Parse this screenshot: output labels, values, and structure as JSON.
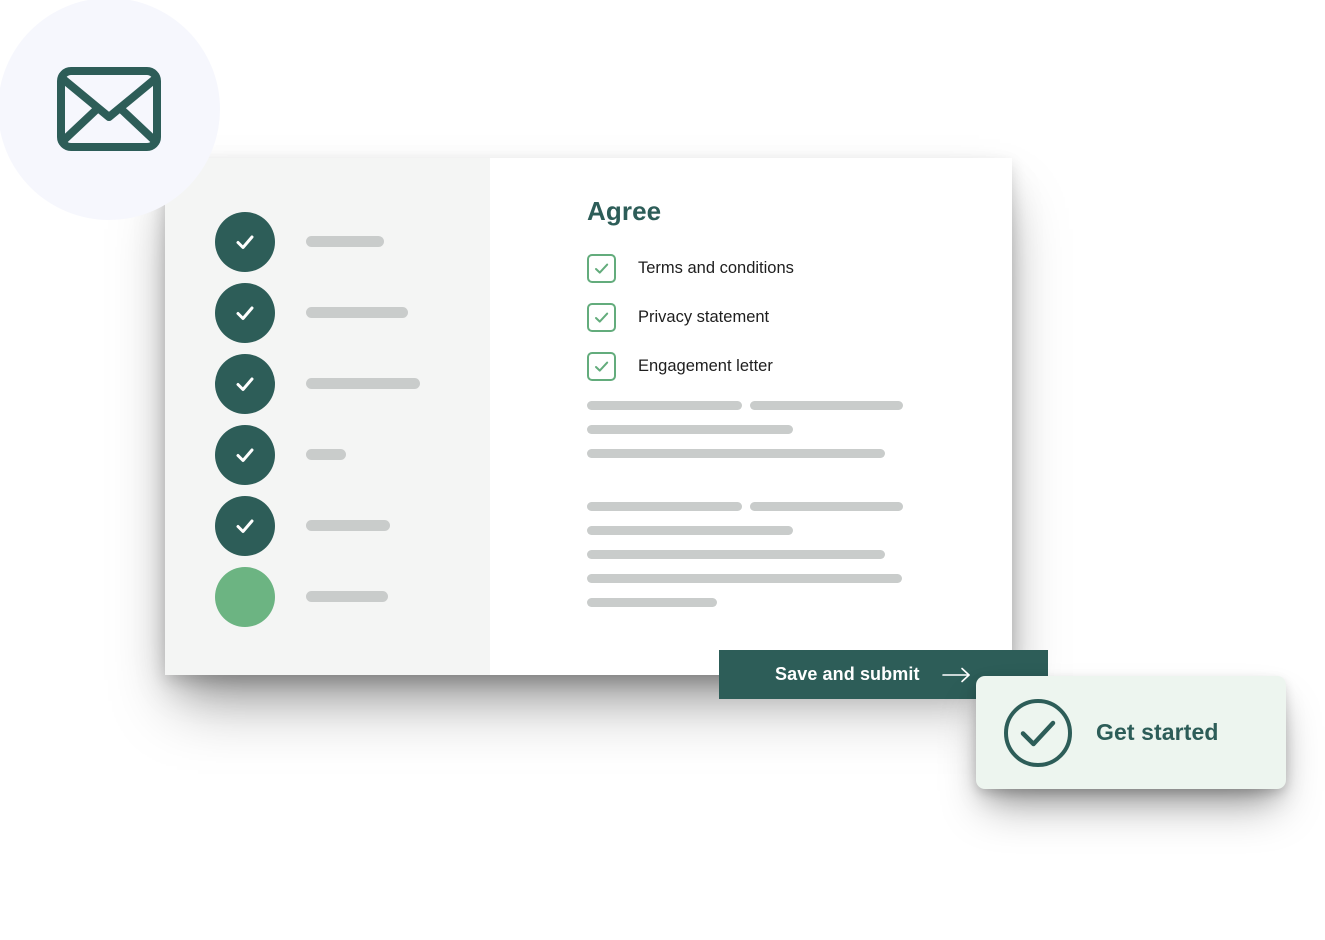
{
  "theme": {
    "teal": "#2d5d58",
    "green_accent": "#6cb482",
    "checkbox_green": "#63ac7c",
    "skeleton_gray": "#c9cccb",
    "sidebar_bg": "#f4f5f4",
    "card_bg": "#ffffff",
    "badge_bg": "#f6f7fd",
    "get_started_bg": "#edf5ef"
  },
  "envelope_badge": {
    "icon": "envelope-icon"
  },
  "stepper": {
    "steps": [
      {
        "state": "complete",
        "icon": "check-icon",
        "label_bar_width": 78
      },
      {
        "state": "complete",
        "icon": "check-icon",
        "label_bar_width": 102
      },
      {
        "state": "complete",
        "icon": "check-icon",
        "label_bar_width": 114
      },
      {
        "state": "complete",
        "icon": "check-icon",
        "label_bar_width": 40
      },
      {
        "state": "complete",
        "icon": "check-icon",
        "label_bar_width": 84
      },
      {
        "state": "current",
        "icon": "",
        "label_bar_width": 82
      }
    ]
  },
  "content": {
    "title": "Agree",
    "agreements": [
      {
        "label": "Terms and conditions",
        "checked": true,
        "icon": "check-icon"
      },
      {
        "label": "Privacy statement",
        "checked": true,
        "icon": "check-icon"
      },
      {
        "label": "Engagement letter",
        "checked": true,
        "icon": "check-icon"
      }
    ],
    "skeleton_blocks": [
      {
        "lines": [
          [
            155,
            153
          ],
          [
            206
          ],
          [
            298
          ]
        ]
      },
      {
        "lines": [
          [
            155,
            153
          ],
          [
            206
          ],
          [
            298
          ],
          [
            315
          ],
          [
            130
          ]
        ]
      }
    ]
  },
  "save_submit": {
    "label": "Save and submit",
    "arrow_icon": "arrow-right-icon"
  },
  "get_started": {
    "label": "Get started",
    "icon": "check-circle-icon"
  }
}
